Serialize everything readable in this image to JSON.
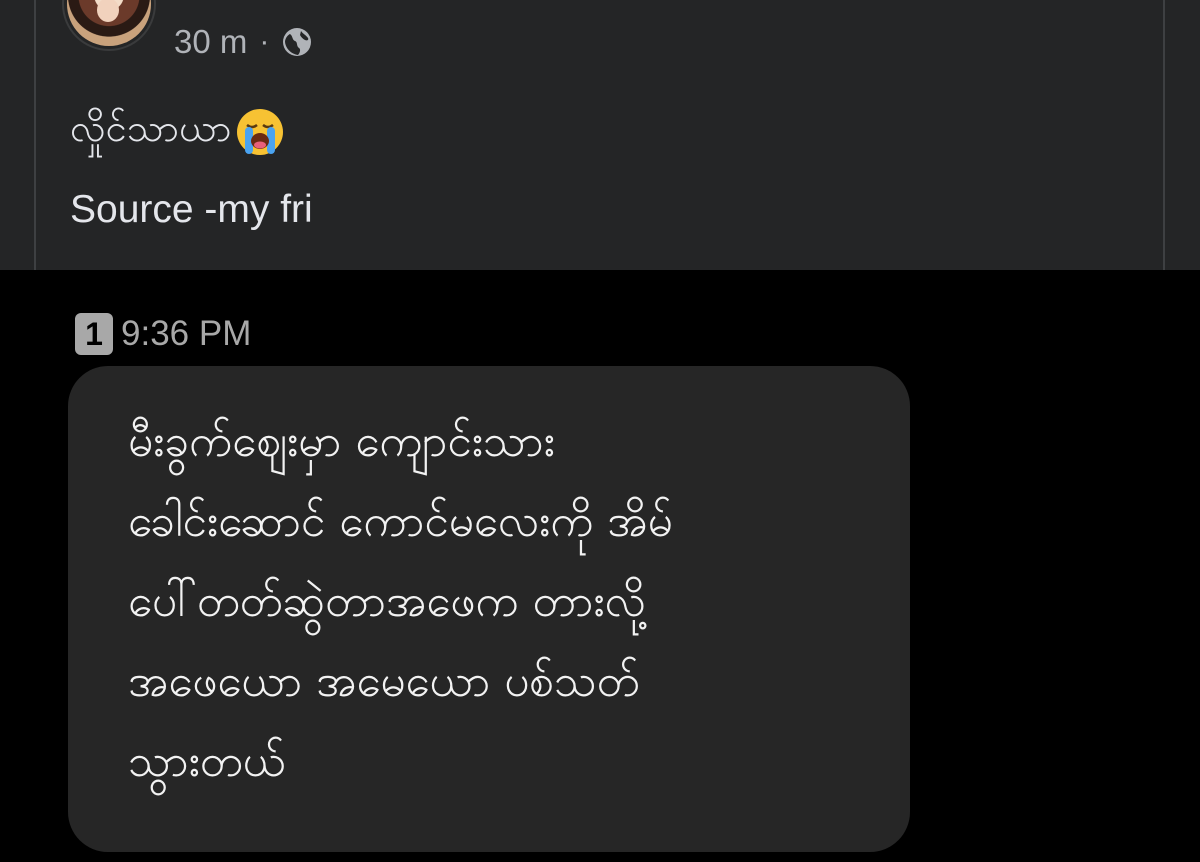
{
  "post": {
    "author": "",
    "time": "30 m",
    "separator": "·",
    "audience_icon": "globe-icon",
    "text_line1": "လှိုင်သာယာ",
    "emoji": "loudly-crying-face",
    "text_line2": "Source -my fri"
  },
  "message": {
    "sim_slot": "1",
    "time": "9:36 PM",
    "lines": [
      "မီးခွက်ဈေးမှာ ကျောင်းသား",
      "ခေါင်းဆောင် ကောင်မလေးကို အိမ်",
      "ပေါ်တတ်ဆွဲတာအဖေက တားလို့",
      "အဖေယော အမေယော ပစ်သတ်",
      "သွားတယ်"
    ]
  },
  "colors": {
    "post_background": "#242526",
    "page_background": "#000000",
    "bubble_background": "#262626",
    "primary_text": "#e4e6eb",
    "secondary_text": "#b0b3b8"
  }
}
